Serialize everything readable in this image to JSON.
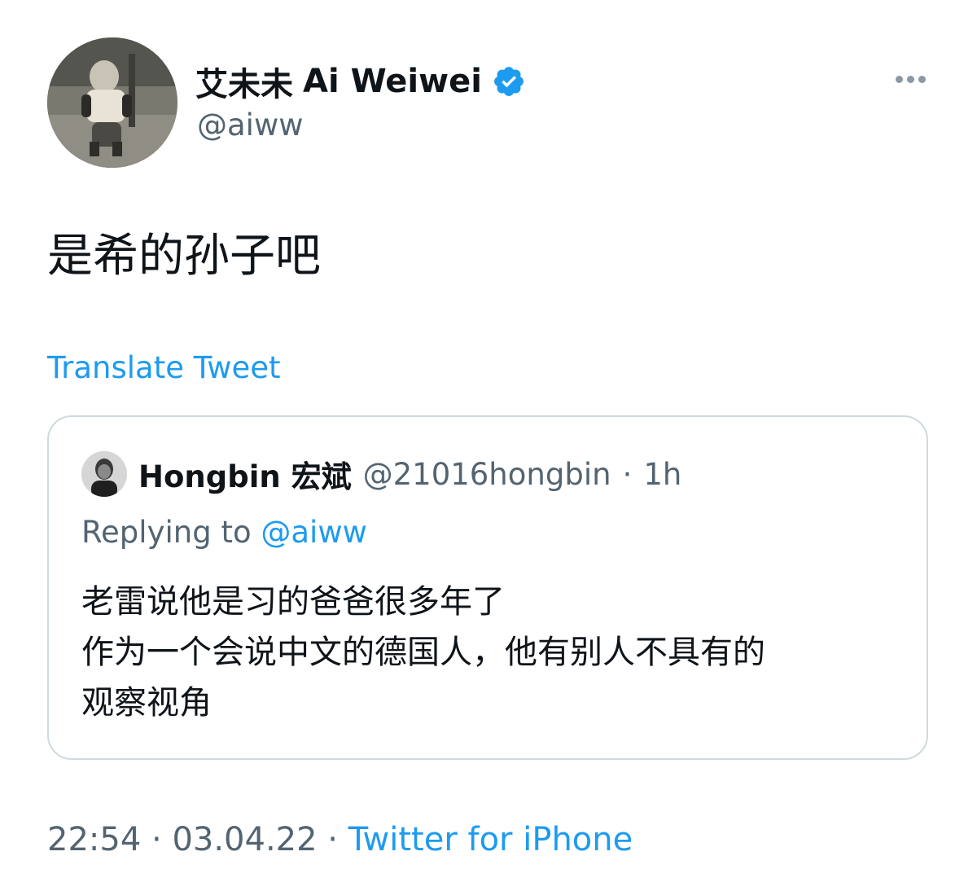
{
  "author": {
    "display_name_cn": "艾未未",
    "display_name_en": "Ai Weiwei",
    "handle": "@aiww",
    "verified_icon": "verified-badge-icon"
  },
  "tweet": {
    "text": "是希的孙子吧",
    "translate_label": "Translate Tweet"
  },
  "quoted": {
    "display_name": "Hongbin 宏斌",
    "handle": "@21016hongbin",
    "separator": "·",
    "time": "1h",
    "replying_prefix": "Replying to",
    "replying_handle": "@aiww",
    "lines": [
      "老雷说他是习的爸爸很多年了",
      "作为一个会说中文的德国人，他有别人不具有的",
      "观察视角"
    ]
  },
  "meta": {
    "time": "22:54",
    "separator": "·",
    "date": "03.04.22",
    "source": "Twitter for iPhone"
  },
  "colors": {
    "accent": "#1d9bf0",
    "secondary_text": "#536471",
    "border": "#cfd9de"
  },
  "icons": {
    "more": "more-horizontal-icon",
    "verified": "verified-badge-icon"
  }
}
